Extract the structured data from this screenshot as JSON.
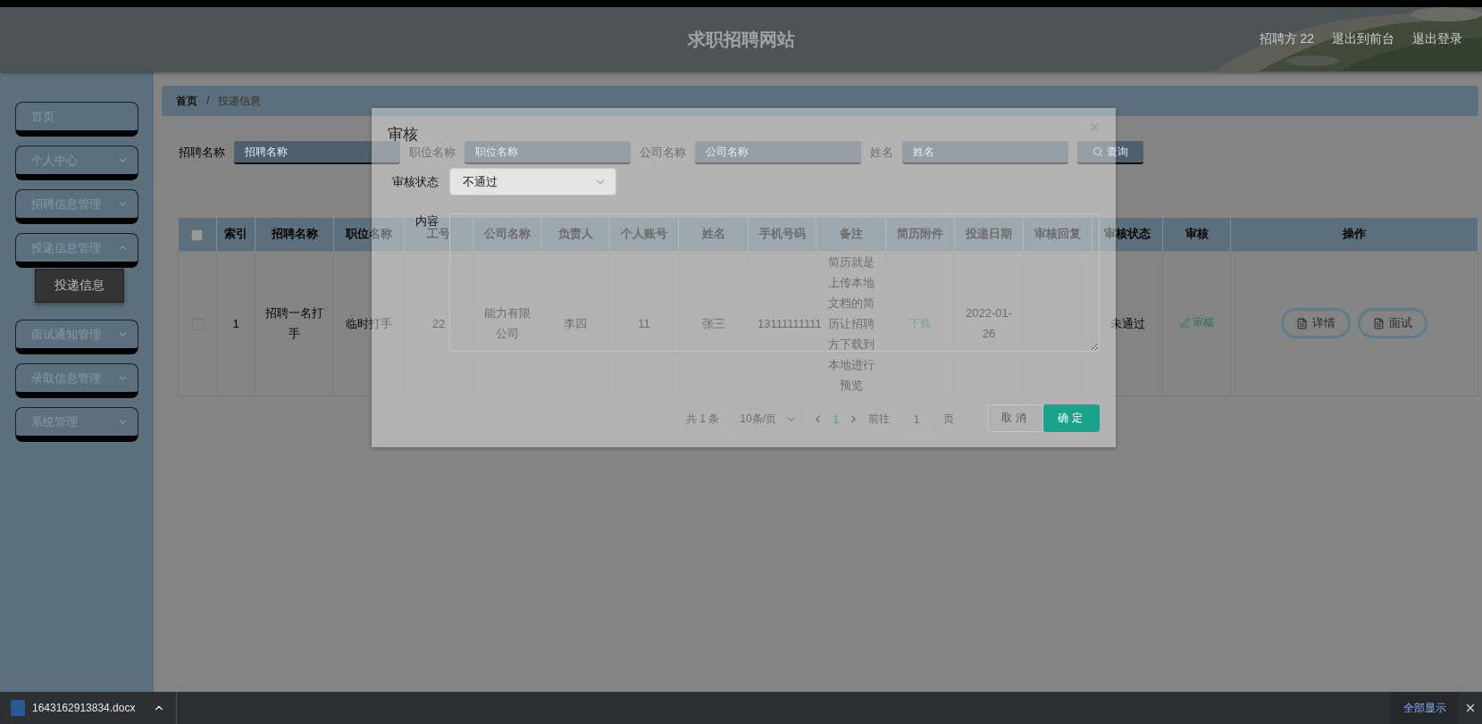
{
  "header": {
    "title": "求职招聘网站",
    "links": [
      "招聘方 22",
      "退出到前台",
      "退出登录"
    ]
  },
  "sidebar": {
    "items": [
      {
        "label": "首页",
        "kind": "link"
      },
      {
        "label": "个人中心",
        "kind": "submenu",
        "expanded": false
      },
      {
        "label": "招聘信息管理",
        "kind": "submenu",
        "expanded": false
      },
      {
        "label": "投递信息管理",
        "kind": "submenu",
        "expanded": true,
        "children": [
          {
            "label": "投递信息",
            "selected": true
          }
        ]
      },
      {
        "label": "面试通知管理",
        "kind": "submenu",
        "expanded": false
      },
      {
        "label": "录取信息管理",
        "kind": "submenu",
        "expanded": false
      },
      {
        "label": "系统管理",
        "kind": "submenu",
        "expanded": false
      }
    ]
  },
  "breadcrumb": {
    "items": [
      "首页",
      "投递信息"
    ],
    "separator": "/"
  },
  "search": {
    "fields": [
      {
        "label": "招聘名称",
        "placeholder": "招聘名称"
      },
      {
        "label": "职位名称",
        "placeholder": "职位名称"
      },
      {
        "label": "公司名称",
        "placeholder": "公司名称"
      },
      {
        "label": "姓名",
        "placeholder": "姓名"
      }
    ],
    "button": "查询"
  },
  "table": {
    "select_all": {
      "checked": false
    },
    "columns": [
      "索引",
      "招聘名称",
      "职位名称",
      "工号",
      "公司名称",
      "负责人",
      "个人账号",
      "姓名",
      "手机号码",
      "备注",
      "简历附件",
      "投递日期",
      "审核回复",
      "审核状态",
      "审核",
      "操作"
    ],
    "rows": [
      {
        "checked": false,
        "cells": [
          {
            "kind": "text",
            "text": "1"
          },
          {
            "kind": "text",
            "text": "招聘一名打手"
          },
          {
            "kind": "text",
            "text": "临时打手"
          },
          {
            "kind": "text",
            "text": "22"
          },
          {
            "kind": "text",
            "text": "能力有限公司"
          },
          {
            "kind": "text",
            "text": "李四"
          },
          {
            "kind": "text",
            "text": "11"
          },
          {
            "kind": "text",
            "text": "张三"
          },
          {
            "kind": "text",
            "text": "13111111111"
          },
          {
            "kind": "text",
            "text": "简历就是上传本地文档的简历让招聘方下载到本地进行预览"
          },
          {
            "kind": "link",
            "text": "下载"
          },
          {
            "kind": "text",
            "text": "2022-01-26"
          },
          {
            "kind": "empty"
          },
          {
            "kind": "text",
            "text": "未通过"
          },
          {
            "kind": "action",
            "text": "审核"
          },
          {
            "kind": "buttons",
            "buttons": [
              "详情",
              "面试"
            ]
          }
        ]
      }
    ]
  },
  "pagination": {
    "total": "共 1 条",
    "page_size": "10条/页",
    "pages": [
      {
        "label": "1",
        "selected": true
      }
    ],
    "goto_label": "前往",
    "goto_value": "1",
    "page_suffix": "页"
  },
  "dialog": {
    "title": "审核",
    "fields": [
      {
        "label": "审核状态",
        "kind": "select",
        "value": "不通过"
      },
      {
        "label": "内容",
        "kind": "textarea"
      }
    ],
    "buttons": [
      {
        "label": "取消",
        "kind": "secondary"
      },
      {
        "label": "确定",
        "kind": "primary"
      }
    ]
  },
  "download_bar": {
    "file": "1643162913834.docx",
    "show_all": "全部显示"
  }
}
